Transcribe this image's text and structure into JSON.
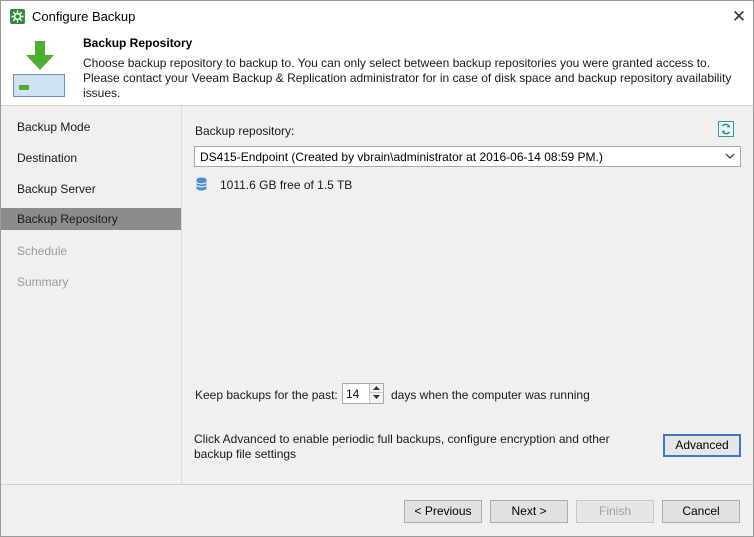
{
  "window": {
    "title": "Configure Backup"
  },
  "header": {
    "title": "Backup Repository",
    "description": "Choose backup repository to backup to. You can only select between backup repositories you were granted access to. Please contact your Veeam Backup & Replication administrator for in case of disk space and backup repository availability issues."
  },
  "sidebar": {
    "items": [
      {
        "label": "Backup Mode",
        "state": "normal"
      },
      {
        "label": "Destination",
        "state": "normal"
      },
      {
        "label": "Backup Server",
        "state": "normal"
      },
      {
        "label": "Backup Repository",
        "state": "active"
      },
      {
        "label": "Schedule",
        "state": "disabled"
      },
      {
        "label": "Summary",
        "state": "disabled"
      }
    ]
  },
  "repository": {
    "label": "Backup repository:",
    "selected": "DS415-Endpoint (Created by vbrain\\administrator at 2016-06-14 08:59 PM.)",
    "free_space": "1011.6 GB free of 1.5 TB"
  },
  "retention": {
    "prefix": "Keep backups for the past:",
    "value": "14",
    "suffix": "days when the computer was running"
  },
  "advanced": {
    "text": "Click Advanced to enable periodic full backups, configure encryption and other backup file settings",
    "button_label": "Advanced"
  },
  "footer": {
    "previous_label": "< Previous",
    "next_label": "Next >",
    "finish_label": "Finish",
    "cancel_label": "Cancel"
  },
  "icons": {
    "app": "veeam-app-icon",
    "header": "download-to-drive-icon",
    "refresh": "refresh-icon",
    "storage": "database-icon",
    "close": "close-icon"
  },
  "colors": {
    "accent": "#3c78c8",
    "active_nav": "#8c8c8c",
    "header_arrow": "#4caf2e"
  }
}
